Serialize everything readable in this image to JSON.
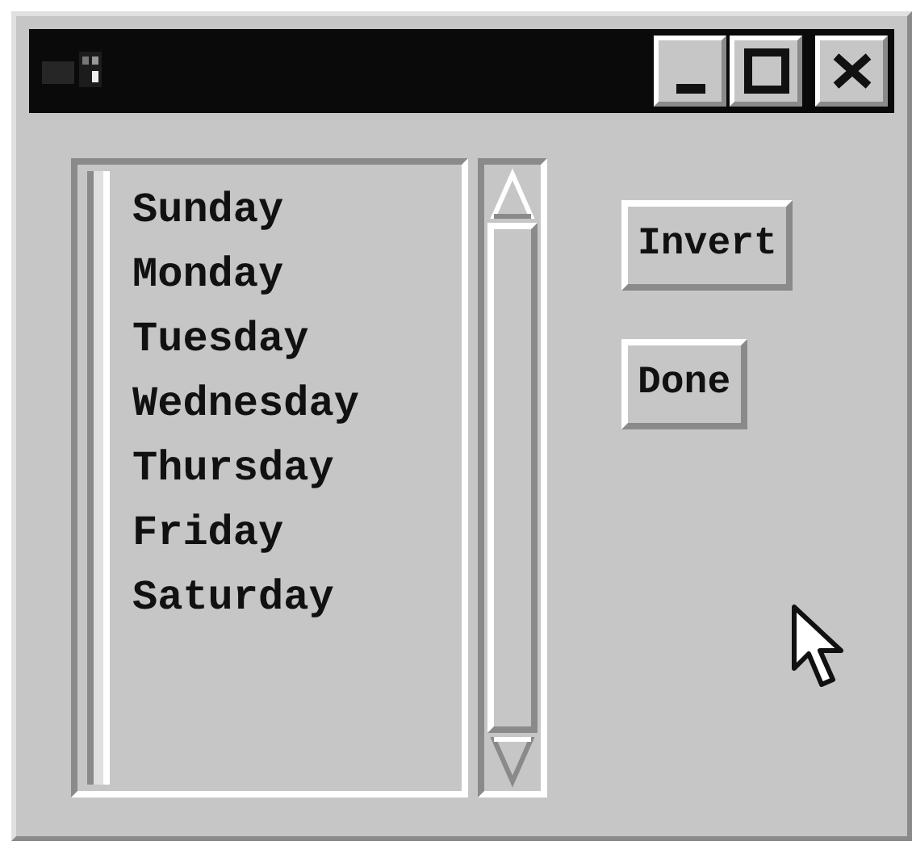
{
  "list": {
    "items": [
      {
        "label": "Sunday"
      },
      {
        "label": "Monday"
      },
      {
        "label": "Tuesday"
      },
      {
        "label": "Wednesday"
      },
      {
        "label": "Thursday"
      },
      {
        "label": "Friday"
      },
      {
        "label": "Saturday"
      }
    ]
  },
  "buttons": [
    {
      "label": "Invert"
    },
    {
      "label": "Done"
    }
  ]
}
